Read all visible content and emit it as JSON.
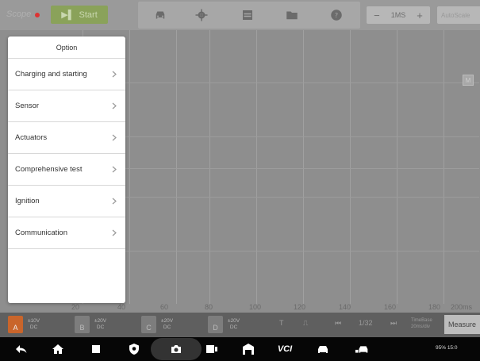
{
  "toolbar": {
    "logo": "Scope",
    "start_label": "Start",
    "timebase": "1MS",
    "minus": "−",
    "plus": "+",
    "autoset_label": "AutoScale"
  },
  "graph": {
    "right_chip": "M",
    "x_ticks": [
      "20",
      "40",
      "60",
      "80",
      "100",
      "120",
      "140",
      "160",
      "180",
      "200ms"
    ]
  },
  "option_panel": {
    "title": "Option",
    "items": [
      {
        "label": "Charging and starting"
      },
      {
        "label": "Sensor"
      },
      {
        "label": "Actuators"
      },
      {
        "label": "Comprehensive test"
      },
      {
        "label": "Ignition"
      },
      {
        "label": "Communication"
      }
    ]
  },
  "channel_bar": {
    "channels": [
      {
        "letter": "A",
        "range": "±10V",
        "coupling": "DC",
        "color": "#c9652b"
      },
      {
        "letter": "B",
        "range": "±20V",
        "coupling": "DC",
        "color": "#7d7d7d"
      },
      {
        "letter": "C",
        "range": "±20V",
        "coupling": "DC",
        "color": "#7d7d7d"
      },
      {
        "letter": "D",
        "range": "±20V",
        "coupling": "DC",
        "color": "#7d7d7d"
      }
    ],
    "trigger": "T",
    "page": "1/32",
    "timebase_label": "TimeBase",
    "timebase_value": "20ms/div",
    "measure_label": "Measure"
  },
  "navbar": {
    "vci_label": "VCI",
    "status": "95% 15:0"
  },
  "colors": {
    "accent_green": "#8aa25a",
    "channel_a": "#c9652b",
    "panel_bg": "#ffffff"
  }
}
